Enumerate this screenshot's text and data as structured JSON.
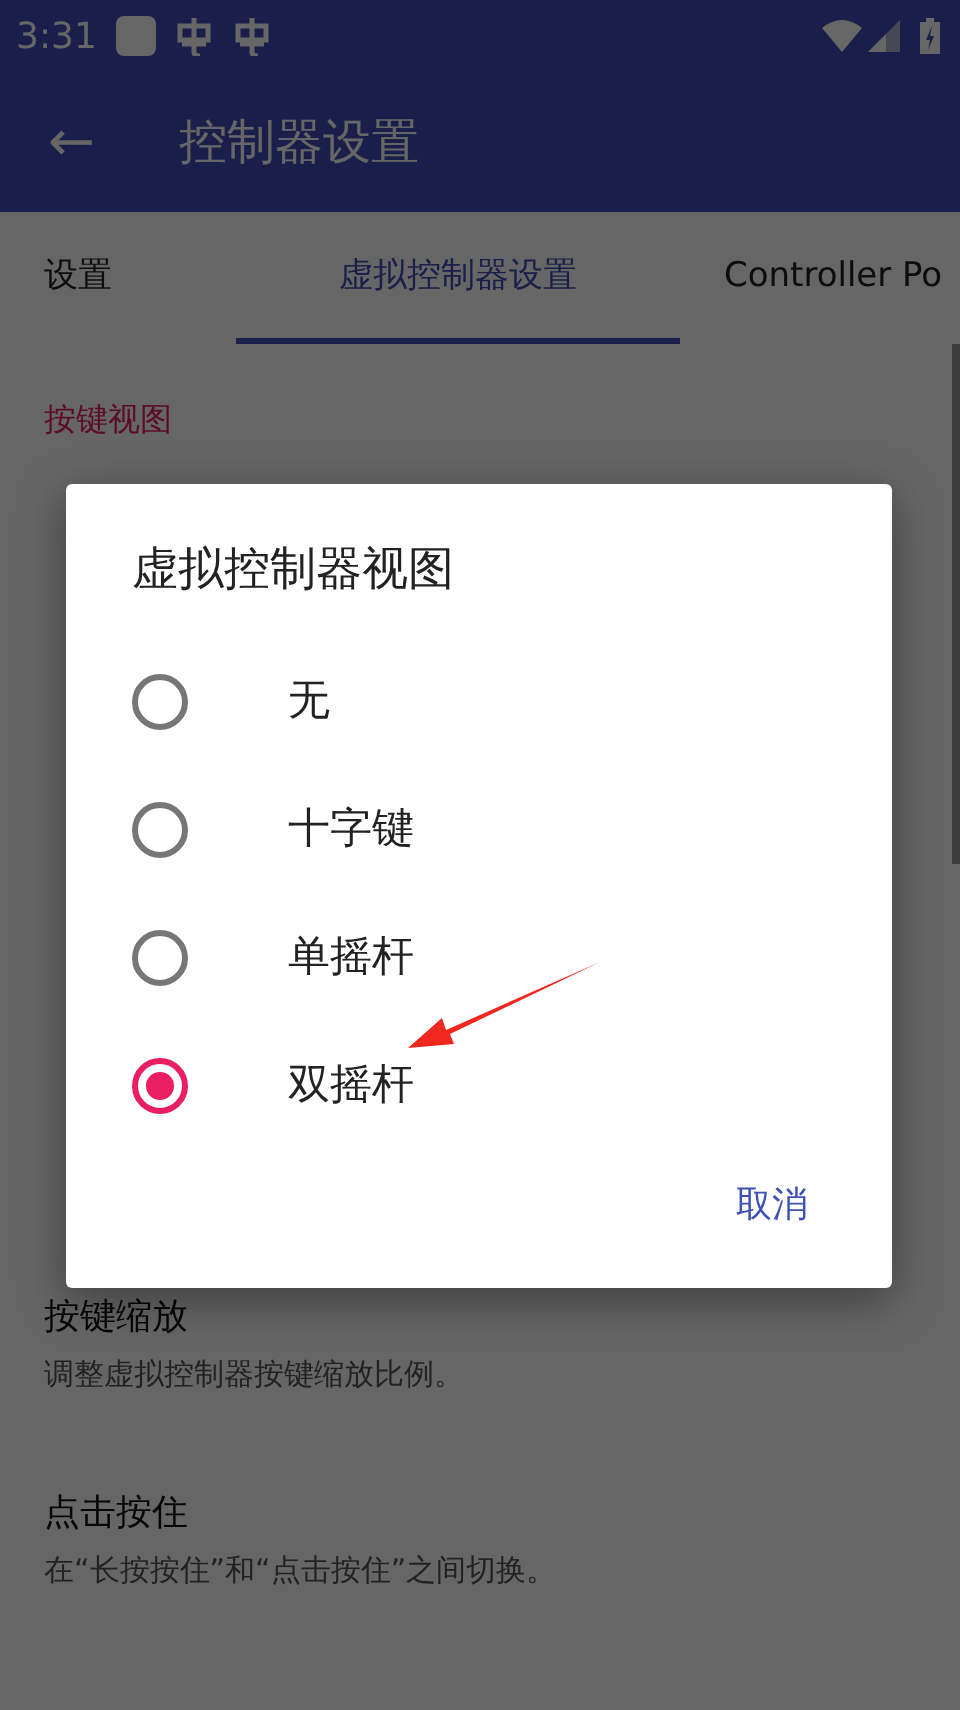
{
  "status_bar": {
    "time": "3:31"
  },
  "app_bar": {
    "back": "←",
    "title": "控制器设置"
  },
  "tabs": [
    {
      "label": "设置",
      "selected": false
    },
    {
      "label": "虚拟控制器设置",
      "selected": true
    },
    {
      "label": "Controller Po",
      "selected": false
    }
  ],
  "section_header": "按键视图",
  "settings": [
    {
      "title": "按键缩放",
      "subtitle": "调整虚拟控制器按键缩放比例。"
    },
    {
      "title": "点击按住",
      "subtitle": "在“长按按住”和“点击按住”之间切换。"
    }
  ],
  "dialog": {
    "title": "虚拟控制器视图",
    "options": [
      {
        "label": "无",
        "selected": false
      },
      {
        "label": "十字键",
        "selected": false
      },
      {
        "label": "单摇杆",
        "selected": false
      },
      {
        "label": "双摇杆",
        "selected": true
      }
    ],
    "cancel": "取消"
  }
}
